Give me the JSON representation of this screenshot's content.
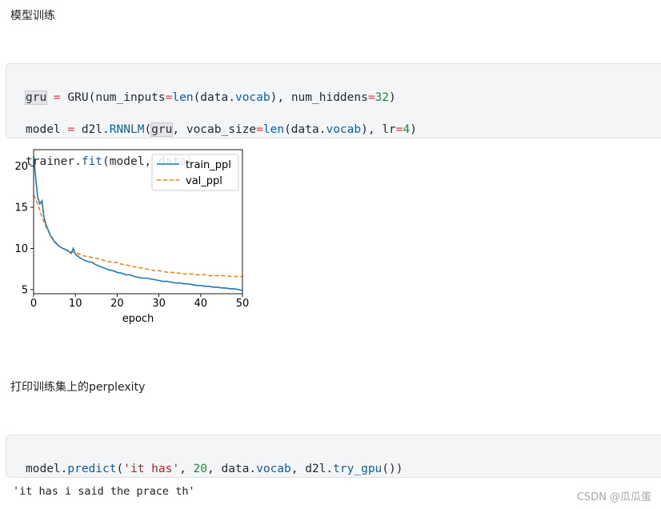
{
  "sections": {
    "training_heading": "模型训练",
    "perplexity_heading": "打印训练集上的perplexity"
  },
  "code_cell_1": {
    "line1": [
      "gru",
      " = ",
      "GRU",
      "(num_inputs",
      "=",
      "len",
      "(data.",
      "vocab",
      "), num_hiddens",
      "=",
      "32",
      ")"
    ],
    "line2": [
      "model",
      " = ",
      "d2l.",
      "RNNLM",
      "(",
      "gru",
      ", vocab_size",
      "=",
      "len",
      "(data.",
      "vocab",
      "), lr",
      "=",
      "4",
      ")"
    ],
    "line3": [
      "trainer.",
      "fit",
      "(model, data)"
    ]
  },
  "code_cell_2": {
    "line1": [
      "model.",
      "predict",
      "(",
      "'it has'",
      ", ",
      "20",
      ", data.",
      "vocab",
      ", d2l.",
      "try_gpu",
      "())"
    ]
  },
  "output": {
    "predict_result": "'it has i said the prace th'"
  },
  "watermark": "CSDN @瓜瓜蛋",
  "colors": {
    "train": "#1f77b4",
    "val": "#ff7f0e",
    "code_bg": "#f4f5f7"
  },
  "chart_data": {
    "type": "line",
    "xlabel": "epoch",
    "ylabel": "",
    "xlim": [
      0,
      50
    ],
    "ylim": [
      4.5,
      22
    ],
    "xticks": [
      0,
      10,
      20,
      30,
      40,
      50
    ],
    "yticks": [
      5,
      10,
      15,
      20
    ],
    "legend_position": "top-right",
    "series": [
      {
        "name": "train_ppl",
        "style": "solid",
        "x": [
          0,
          0.5,
          1,
          1.5,
          2,
          2.5,
          3,
          3.5,
          4,
          5,
          6,
          7,
          8,
          9,
          9.5,
          10,
          11,
          12,
          13,
          14,
          15,
          16,
          17,
          18,
          19,
          20,
          21,
          22,
          23,
          24,
          25,
          26,
          27,
          28,
          29,
          30,
          31,
          32,
          33,
          34,
          35,
          36,
          37,
          38,
          39,
          40,
          41,
          42,
          43,
          44,
          45,
          46,
          47,
          48,
          49,
          50
        ],
        "y": [
          21.2,
          18.5,
          16.2,
          15.4,
          15.8,
          13.8,
          12.8,
          12.2,
          11.6,
          10.8,
          10.3,
          10.0,
          9.8,
          9.4,
          10.0,
          9.3,
          8.9,
          8.6,
          8.4,
          8.3,
          8.0,
          7.8,
          7.6,
          7.4,
          7.3,
          7.1,
          7.0,
          6.8,
          6.8,
          6.6,
          6.5,
          6.4,
          6.4,
          6.3,
          6.2,
          6.1,
          6.0,
          6.0,
          5.9,
          5.8,
          5.8,
          5.7,
          5.7,
          5.6,
          5.5,
          5.5,
          5.4,
          5.4,
          5.3,
          5.3,
          5.2,
          5.2,
          5.1,
          5.1,
          5.0,
          4.9
        ]
      },
      {
        "name": "val_ppl",
        "style": "dashed",
        "x": [
          0,
          0.5,
          1,
          1.5,
          2,
          3,
          4,
          5,
          6,
          7,
          8,
          9,
          10,
          11,
          12,
          13,
          14,
          15,
          16,
          17,
          18,
          19,
          20,
          21,
          22,
          23,
          24,
          25,
          26,
          27,
          28,
          29,
          30,
          31,
          32,
          33,
          34,
          35,
          36,
          37,
          38,
          39,
          40,
          41,
          42,
          43,
          44,
          45,
          46,
          47,
          48,
          49,
          50
        ],
        "y": [
          16.5,
          16.0,
          15.3,
          14.6,
          13.8,
          12.6,
          11.6,
          10.9,
          10.3,
          10.0,
          9.8,
          9.6,
          9.5,
          9.3,
          9.1,
          9.0,
          8.9,
          8.8,
          8.7,
          8.5,
          8.4,
          8.3,
          8.3,
          8.1,
          8.0,
          7.9,
          7.8,
          7.7,
          7.6,
          7.5,
          7.4,
          7.3,
          7.3,
          7.2,
          7.1,
          7.1,
          7.0,
          7.0,
          6.9,
          6.9,
          6.9,
          6.8,
          6.8,
          6.8,
          6.7,
          6.7,
          6.7,
          6.7,
          6.7,
          6.6,
          6.6,
          6.6,
          6.6
        ]
      }
    ]
  }
}
